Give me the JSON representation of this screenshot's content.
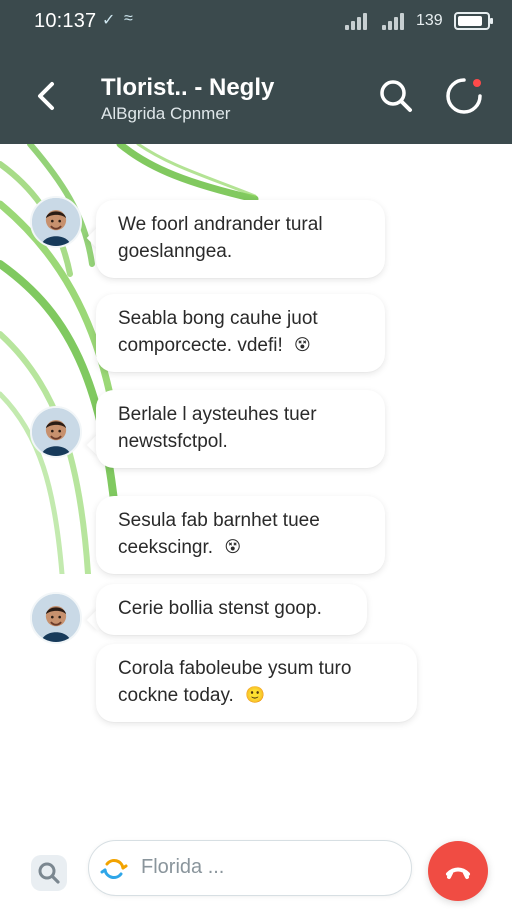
{
  "status": {
    "time": "10:137",
    "icon_a": "✓",
    "icon_b": "≈",
    "battery_percent_text": "139",
    "battery_level": 0.85
  },
  "appbar": {
    "title": "Tlorist.. - Negly",
    "subtitle": "AlBgrida Cpnmer"
  },
  "messages": [
    {
      "line1": "We foorl andrander tural",
      "line2": "goeslanngea.",
      "avatar": true
    },
    {
      "line1": "Seabla bong cauhe juot",
      "line2": "comporcecte.       vdefi!",
      "emoji": "😵",
      "avatar": false
    },
    {
      "line1": "Berlale l aysteuhes tuer",
      "line2": "newstsfctpol.",
      "avatar": true
    },
    {
      "line1": "Sesula fab barnhet tuee",
      "line2": "ceekscingr.",
      "emoji": "😵",
      "avatar": false
    },
    {
      "line1": "Cerie bollia stenst goop.",
      "avatar": true
    },
    {
      "line1": "Corola faboleube ysum turo",
      "line2": "cockne today.",
      "emoji": "🙂",
      "avatar": false
    }
  ],
  "input": {
    "placeholder": "Florida ..."
  },
  "icons": {
    "back": "chevron-left",
    "search": "magnifier",
    "status": "ring-with-dot",
    "end_call": "phone-hangup"
  },
  "colors": {
    "header_bg": "#3b4a4d",
    "accent_red": "#f04c43"
  }
}
